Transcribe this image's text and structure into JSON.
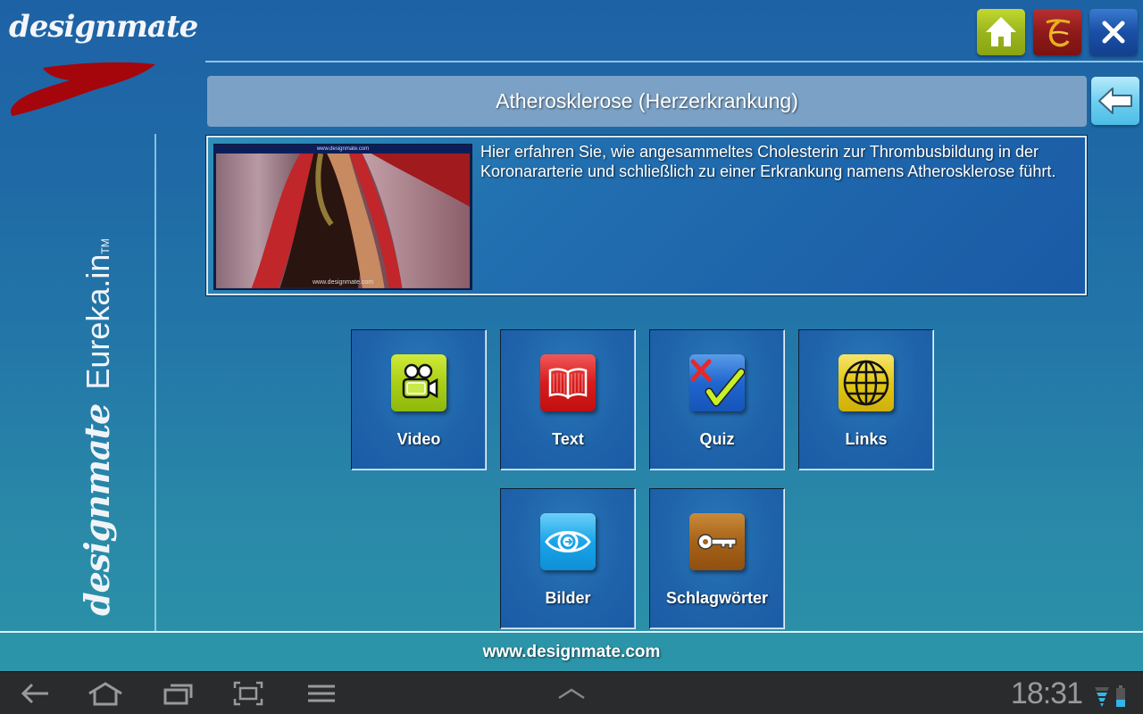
{
  "app": {
    "brand": "designmate",
    "product": "Eureka.in",
    "trademark": "TM"
  },
  "colors": {
    "accent_red": "#a4060c",
    "home_green": "#9ab51d",
    "eureka_red": "#8f1a1a",
    "close_blue": "#1a4fa6",
    "back_cyan": "#6fd0f0",
    "title_bar": "#7ba2c6"
  },
  "header": {
    "title": "Atherosklerose (Herzerkrankung)",
    "buttons": [
      {
        "name": "home",
        "icon": "home-icon"
      },
      {
        "name": "eureka",
        "icon": "eureka-logo-icon"
      },
      {
        "name": "close",
        "icon": "close-icon"
      }
    ],
    "back_icon": "arrow-left-icon"
  },
  "intro": {
    "thumbnail_top_caption": "www.designmate.com",
    "thumbnail_bottom_caption": "www.designmate.com",
    "description": "Hier erfahren Sie, wie angesammeltes Cholesterin zur Thrombusbildung in der Koronararterie und schließlich zu einer Erkrankung namens Atherosklerose führt."
  },
  "tiles": [
    {
      "label": "Video",
      "icon": "video-camera-icon"
    },
    {
      "label": "Text",
      "icon": "book-icon"
    },
    {
      "label": "Quiz",
      "icon": "quiz-check-icon"
    },
    {
      "label": "Links",
      "icon": "globe-icon"
    },
    {
      "label": "Bilder",
      "icon": "eye-icon"
    },
    {
      "label": "Schlagwörter",
      "icon": "key-icon"
    }
  ],
  "footer": {
    "url": "www.designmate.com"
  },
  "system_bar": {
    "nav": [
      "back-icon",
      "home-icon",
      "recent-apps-icon",
      "screenshot-icon",
      "menu-icon"
    ],
    "time": "18:31",
    "status_icons": [
      "wifi-icon",
      "battery-icon"
    ]
  }
}
